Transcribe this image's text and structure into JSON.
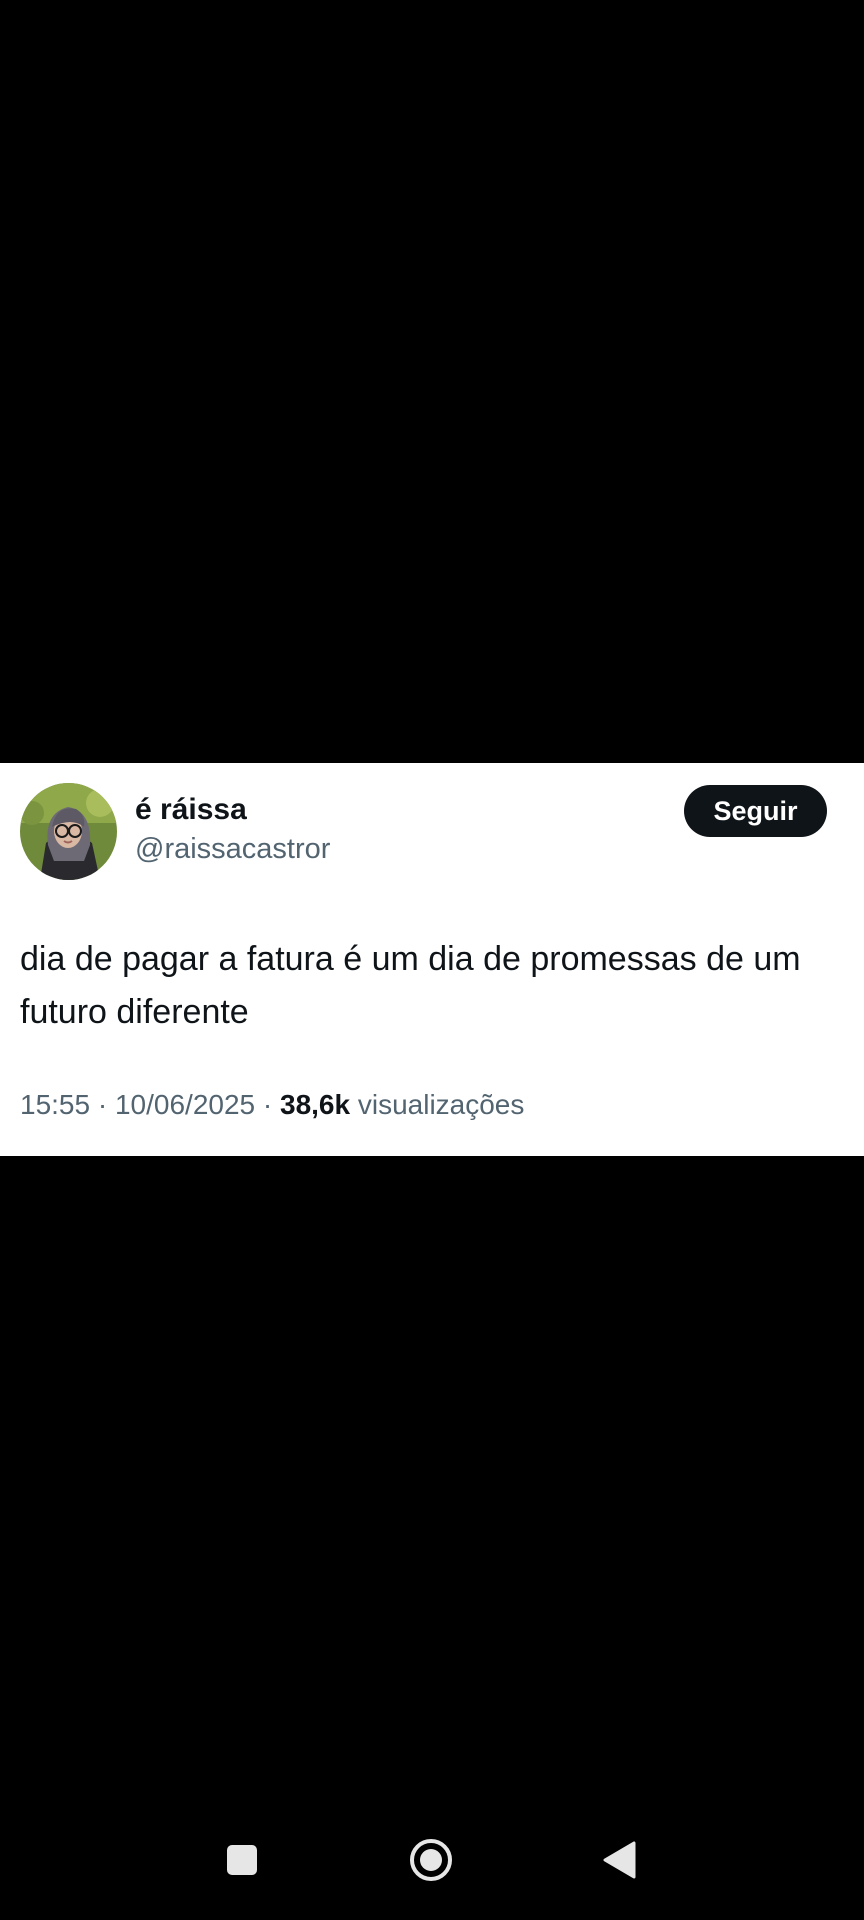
{
  "tweet": {
    "display_name": "é ráissa",
    "handle": "@raissacastror",
    "follow_label": "Seguir",
    "text": "dia de pagar a fatura é um dia de promessas de um futuro diferente",
    "time": "15:55",
    "separator": "·",
    "date": "10/06/2025",
    "views_count": "38,6k",
    "views_label": "visualizações"
  },
  "nav": {
    "recents_icon": "square-recents-icon",
    "home_icon": "circle-home-icon",
    "back_icon": "triangle-back-icon"
  },
  "colors": {
    "background": "#000000",
    "card": "#ffffff",
    "primary_text": "#0f1419",
    "secondary_text": "#536471",
    "follow_button": "#0f1419",
    "nav_icons": "#e6e6e6"
  }
}
